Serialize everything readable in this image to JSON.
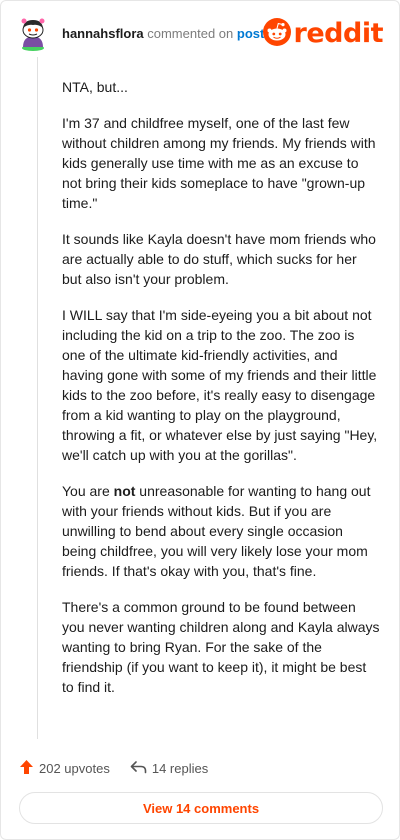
{
  "header": {
    "username": "hannahsflora",
    "action_text": "commented on",
    "post_link": "post",
    "logo_text": "reddit"
  },
  "comment": {
    "p1": "NTA, but...",
    "p2": "I'm 37 and childfree myself, one of the last few without children among my friends. My friends with kids generally use time with me as an excuse to not bring their kids someplace to have \"grown-up time.\"",
    "p3": "It sounds like Kayla doesn't have mom friends who are actually able to do stuff, which sucks for her but also isn't your problem.",
    "p4": "I WILL say that I'm side-eyeing you a bit about not including the kid on a trip to the zoo. The zoo is one of the ultimate kid-friendly activities, and having gone with some of my friends and their little kids to the zoo before, it's really easy to disengage from a kid wanting to play on the playground, throwing a fit, or whatever else by just saying \"Hey, we'll catch up with you at the gorillas\".",
    "p5_before": "You are ",
    "p5_bold": "not",
    "p5_after": " unreasonable for wanting to hang out with your friends without kids. But if you are unwilling to bend about every single occasion being childfree, you will very likely lose your mom friends. If that's okay with you, that's fine.",
    "p6": "There's a common ground to be found between you never wanting children along and Kayla always wanting to bring Ryan. For the sake of the friendship (if you want to keep it), it might be best to find it."
  },
  "footer": {
    "upvotes": "202 upvotes",
    "replies": "14 replies",
    "view_button": "View 14 comments"
  },
  "icons": {
    "avatar": "snoo-avatar-icon",
    "logo": "reddit-snoo-icon",
    "upvote": "upvote-arrow-icon",
    "reply": "reply-arrow-icon"
  },
  "colors": {
    "brand": "#ff4500",
    "link": "#0079d3",
    "text": "#1c1c1c",
    "muted": "#7c7c7c",
    "border": "#e6e6e6"
  }
}
